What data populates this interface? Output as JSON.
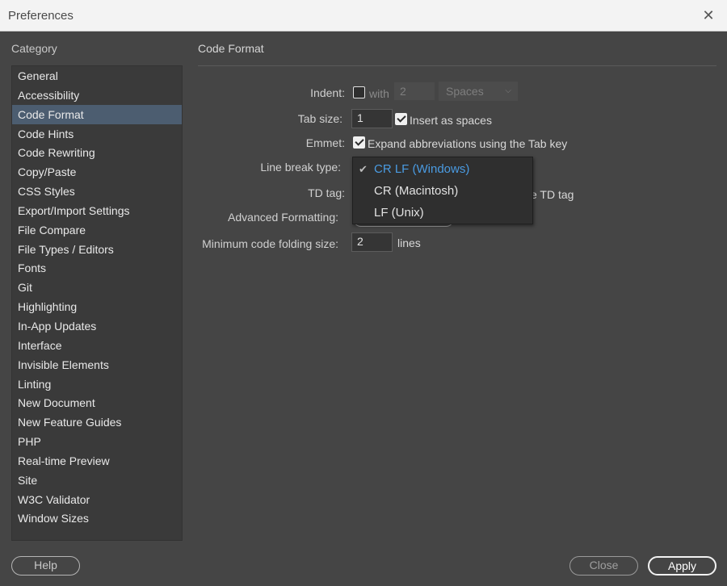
{
  "window": {
    "title": "Preferences"
  },
  "sidebar": {
    "heading": "Category",
    "items": [
      {
        "label": "General"
      },
      {
        "label": "Accessibility"
      },
      {
        "label": "Code Format",
        "selected": true
      },
      {
        "label": "Code Hints"
      },
      {
        "label": "Code Rewriting"
      },
      {
        "label": "Copy/Paste"
      },
      {
        "label": "CSS Styles"
      },
      {
        "label": "Export/Import Settings"
      },
      {
        "label": "File Compare"
      },
      {
        "label": "File Types / Editors"
      },
      {
        "label": "Fonts"
      },
      {
        "label": "Git"
      },
      {
        "label": "Highlighting"
      },
      {
        "label": "In-App Updates"
      },
      {
        "label": "Interface"
      },
      {
        "label": "Invisible Elements"
      },
      {
        "label": "Linting"
      },
      {
        "label": "New Document"
      },
      {
        "label": "New Feature Guides"
      },
      {
        "label": "PHP"
      },
      {
        "label": "Real-time Preview"
      },
      {
        "label": "Site"
      },
      {
        "label": "W3C Validator"
      },
      {
        "label": "Window Sizes"
      }
    ]
  },
  "panel": {
    "title": "Code Format",
    "indent": {
      "label": "Indent:",
      "checked": false,
      "with_label": "with",
      "value": "2",
      "unit": "Spaces"
    },
    "tab_size": {
      "label": "Tab size:",
      "value": "1",
      "insert_spaces_label": "Insert as spaces",
      "insert_spaces_checked": true
    },
    "emmet": {
      "label": "Emmet:",
      "checked": true,
      "text": "Expand abbreviations using the Tab key"
    },
    "line_break": {
      "label": "Line break type:"
    },
    "td_tag": {
      "label": "TD tag:",
      "partial_text": "e TD tag"
    },
    "advanced": {
      "label": "Advanced Formatting:"
    },
    "folding": {
      "label": "Minimum code folding size:",
      "value": "2",
      "unit": "lines"
    }
  },
  "dropdown": {
    "options": [
      {
        "label": "CR LF (Windows)",
        "selected": true
      },
      {
        "label": "CR (Macintosh)"
      },
      {
        "label": "LF (Unix)"
      }
    ]
  },
  "buttons": {
    "help": "Help",
    "close": "Close",
    "apply": "Apply"
  },
  "colors": {
    "accent": "#4a9be2",
    "selection": "#4c5d70",
    "panel_bg": "#454545"
  }
}
